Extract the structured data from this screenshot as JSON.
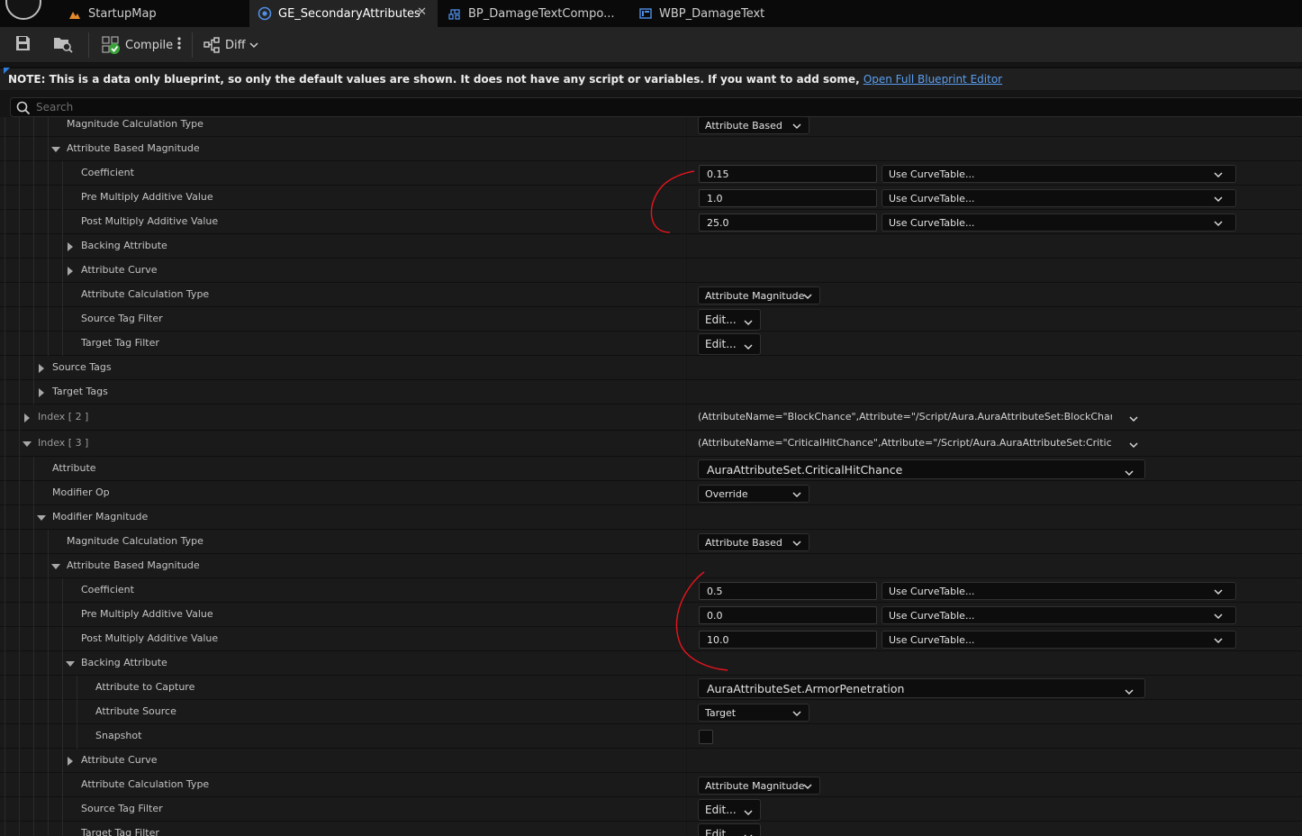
{
  "tabs": [
    {
      "label": "StartupMap",
      "active": false
    },
    {
      "label": "GE_SecondaryAttributes",
      "active": true
    },
    {
      "label": "BP_DamageTextCompo...",
      "active": false
    },
    {
      "label": "WBP_DamageText",
      "active": false
    }
  ],
  "toolbar": {
    "compile_label": "Compile",
    "diff_label": "Diff"
  },
  "note": {
    "text": "NOTE: This is a data only blueprint, so only the default values are shown.  It does not have any script or variables.  If you want to add some, ",
    "link": "Open Full Blueprint Editor"
  },
  "search": {
    "placeholder": "Search"
  },
  "colors": {
    "annotation": "#e8141e",
    "link": "#5a9ff0",
    "accent_tab": "#2f7fe0"
  },
  "rows": [
    {
      "label": "Magnitude Calculation Type",
      "level": 3,
      "value_type": "combo",
      "value": "Attribute Based",
      "combo_width": 124
    },
    {
      "label": "Attribute Based Magnitude",
      "level": 3,
      "expander": "expanded"
    },
    {
      "label": "Coefficient",
      "level": 4,
      "value_type": "number_curve",
      "value": "0.15",
      "curve": "Use CurveTable..."
    },
    {
      "label": "Pre Multiply Additive Value",
      "level": 4,
      "value_type": "number_curve",
      "value": "1.0",
      "curve": "Use CurveTable..."
    },
    {
      "label": "Post Multiply Additive Value",
      "level": 4,
      "value_type": "number_curve",
      "value": "25.0",
      "curve": "Use CurveTable..."
    },
    {
      "label": "Backing Attribute",
      "level": 4,
      "expander": "collapsed"
    },
    {
      "label": "Attribute Curve",
      "level": 4,
      "expander": "collapsed"
    },
    {
      "label": "Attribute Calculation Type",
      "level": 4,
      "value_type": "combo",
      "value": "Attribute Magnitude",
      "combo_width": 136
    },
    {
      "label": "Source Tag Filter",
      "level": 4,
      "value_type": "edit",
      "value": "Edit..."
    },
    {
      "label": "Target Tag Filter",
      "level": 4,
      "value_type": "edit",
      "value": "Edit..."
    },
    {
      "label": "Source Tags",
      "level": 2,
      "expander": "collapsed"
    },
    {
      "label": "Target Tags",
      "level": 2,
      "expander": "collapsed"
    },
    {
      "label": "Index [ 2 ]",
      "level": 1,
      "expander": "collapsed",
      "dim": true,
      "value_type": "text",
      "value": "(AttributeName=\"BlockChance\",Attribute=\"/Script/Aura.AuraAttributeSet:BlockChance\",Attri",
      "tall": true
    },
    {
      "label": "Index [ 3 ]",
      "level": 1,
      "expander": "expanded",
      "dim": true,
      "value_type": "text",
      "value": "(AttributeName=\"CriticalHitChance\",Attribute=\"/Script/Aura.AuraAttributeSet:CriticalHitCha",
      "tall": true
    },
    {
      "label": "Attribute",
      "level": 2,
      "value_type": "bigcombo",
      "value": "AuraAttributeSet.CriticalHitChance"
    },
    {
      "label": "Modifier Op",
      "level": 2,
      "value_type": "combo",
      "value": "Override",
      "combo_width": 124
    },
    {
      "label": "Modifier Magnitude",
      "level": 2,
      "expander": "expanded"
    },
    {
      "label": "Magnitude Calculation Type",
      "level": 3,
      "value_type": "combo",
      "value": "Attribute Based",
      "combo_width": 124
    },
    {
      "label": "Attribute Based Magnitude",
      "level": 3,
      "expander": "expanded"
    },
    {
      "label": "Coefficient",
      "level": 4,
      "value_type": "number_curve",
      "value": "0.5",
      "curve": "Use CurveTable..."
    },
    {
      "label": "Pre Multiply Additive Value",
      "level": 4,
      "value_type": "number_curve",
      "value": "0.0",
      "curve": "Use CurveTable..."
    },
    {
      "label": "Post Multiply Additive Value",
      "level": 4,
      "value_type": "number_curve",
      "value": "10.0",
      "curve": "Use CurveTable..."
    },
    {
      "label": "Backing Attribute",
      "level": 4,
      "expander": "expanded"
    },
    {
      "label": "Attribute to Capture",
      "level": 5,
      "value_type": "bigcombo",
      "value": "AuraAttributeSet.ArmorPenetration"
    },
    {
      "label": "Attribute Source",
      "level": 5,
      "value_type": "combo",
      "value": "Target",
      "combo_width": 124
    },
    {
      "label": "Snapshot",
      "level": 5,
      "value_type": "checkbox"
    },
    {
      "label": "Attribute Curve",
      "level": 4,
      "expander": "collapsed"
    },
    {
      "label": "Attribute Calculation Type",
      "level": 4,
      "value_type": "combo",
      "value": "Attribute Magnitude",
      "combo_width": 136
    },
    {
      "label": "Source Tag Filter",
      "level": 4,
      "value_type": "edit",
      "value": "Edit..."
    },
    {
      "label": "Target Tag Filter",
      "level": 4,
      "value_type": "edit",
      "value": "Edit..."
    }
  ]
}
